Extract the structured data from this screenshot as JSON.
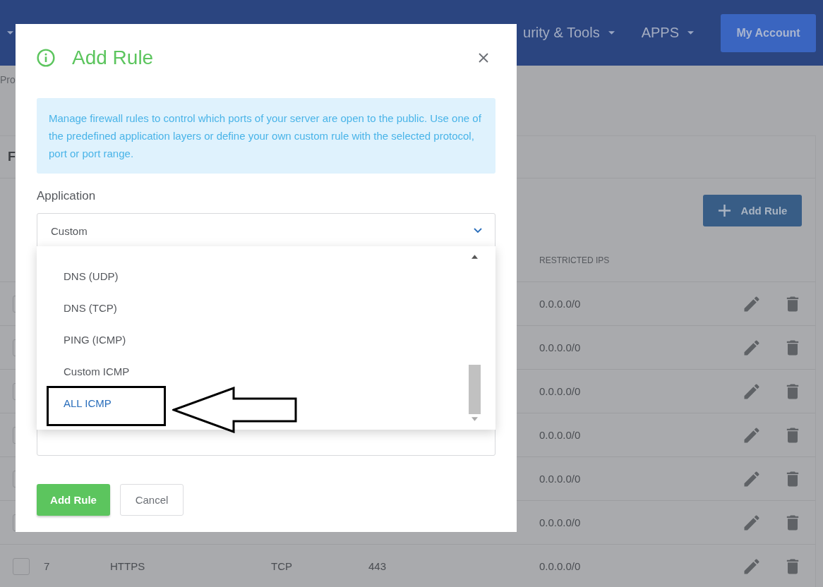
{
  "navbar": {
    "menu_items": [
      {
        "label": "urity & Tools"
      },
      {
        "label": "APPS"
      }
    ],
    "account_button": "My Account"
  },
  "breadcrumb": "Pro",
  "card": {
    "title": "F",
    "add_button": "Add Rule",
    "columns": [
      "RESTRICTED IPS"
    ],
    "rows": [
      {
        "checked": false,
        "restricted_ips": "0.0.0.0/0"
      },
      {
        "checked": false,
        "restricted_ips": "0.0.0.0/0"
      },
      {
        "checked": false,
        "restricted_ips": "0.0.0.0/0"
      },
      {
        "checked": false,
        "restricted_ips": "0.0.0.0/0"
      },
      {
        "checked": false,
        "restricted_ips": "0.0.0.0/0"
      },
      {
        "checked": false,
        "restricted_ips": "0.0.0.0/0"
      },
      {
        "checked": false,
        "number": "7",
        "name": "HTTPS",
        "protocol": "TCP",
        "port": "443",
        "restricted_ips": "0.0.0.0/0"
      }
    ]
  },
  "dialog": {
    "title": "Add Rule",
    "info": "Manage firewall rules to control which ports of your server are open to the public. Use one of the predefined application layers or define your own custom rule with the selected protocol, port or port range.",
    "application_label": "Application",
    "application_value": "Custom",
    "options": [
      {
        "label": "DNS (UDP)",
        "selected": false
      },
      {
        "label": "DNS (TCP)",
        "selected": false
      },
      {
        "label": "PING (ICMP)",
        "selected": false
      },
      {
        "label": "Custom ICMP",
        "selected": false
      },
      {
        "label": "ALL ICMP",
        "selected": true
      }
    ],
    "buttons": {
      "submit": "Add Rule",
      "cancel": "Cancel"
    }
  }
}
